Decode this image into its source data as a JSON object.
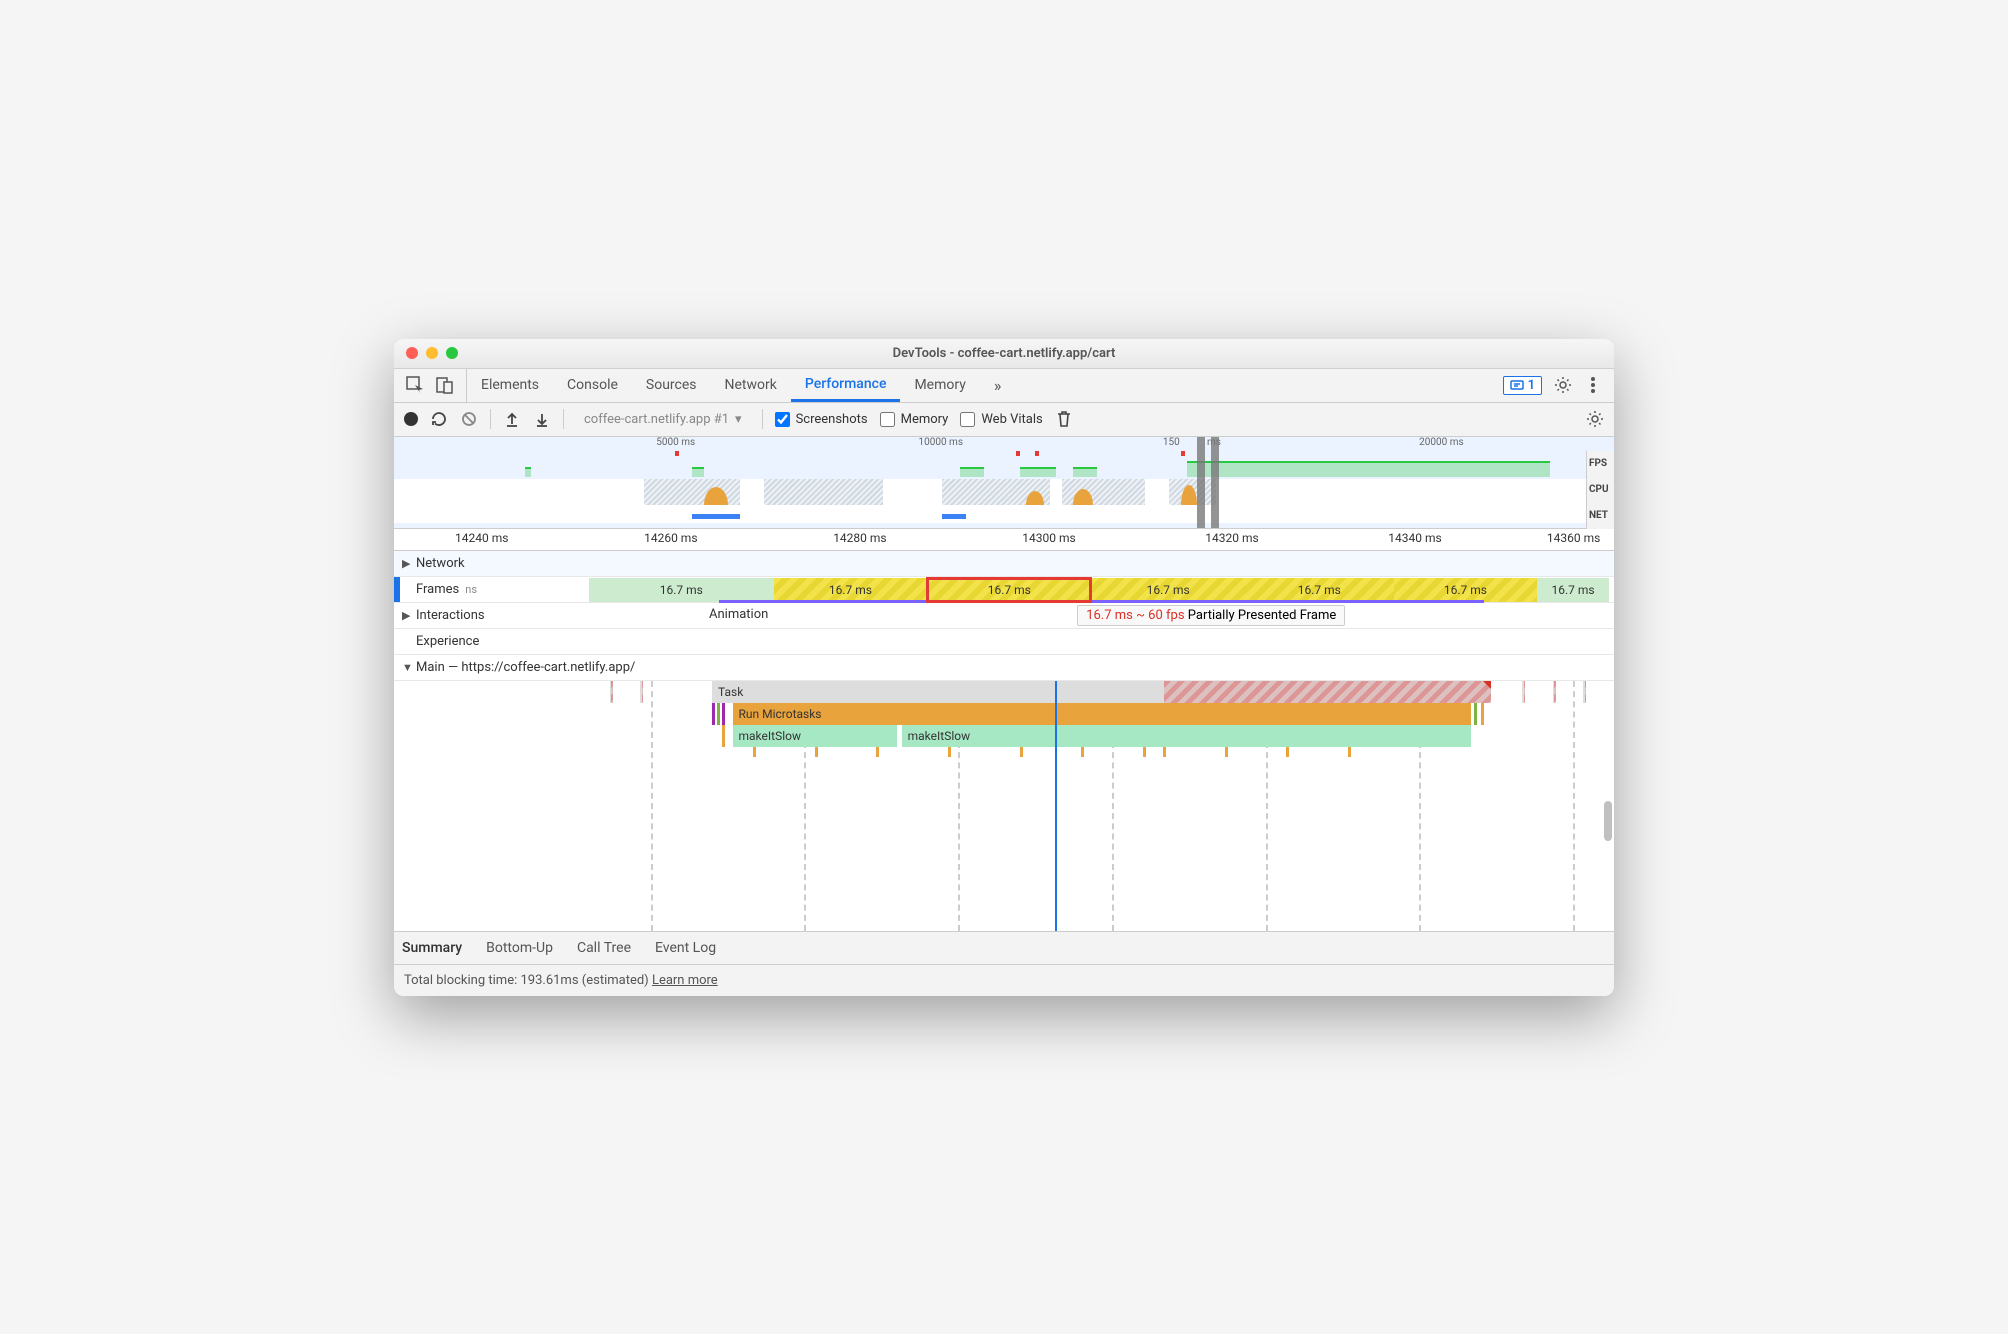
{
  "window": {
    "title": "DevTools - coffee-cart.netlify.app/cart"
  },
  "tabs": {
    "items": [
      "Elements",
      "Console",
      "Sources",
      "Network",
      "Performance",
      "Memory"
    ],
    "active": 4,
    "more": "»",
    "issues_count": "1"
  },
  "toolbar": {
    "dropdown": "coffee-cart.netlify.app #1",
    "screenshots": {
      "label": "Screenshots",
      "checked": true
    },
    "memory": {
      "label": "Memory",
      "checked": false
    },
    "webvitals": {
      "label": "Web Vitals",
      "checked": false
    }
  },
  "overview": {
    "ticks": [
      "5000 ms",
      "10000 ms",
      "150",
      "ms",
      "20000 ms"
    ],
    "labels": [
      "FPS",
      "CPU",
      "NET"
    ]
  },
  "ruler": {
    "ticks": [
      "14240 ms",
      "14260 ms",
      "14280 ms",
      "14300 ms",
      "14320 ms",
      "14340 ms",
      "14360 ms"
    ]
  },
  "tracks": {
    "network": "Network",
    "frames": {
      "label": "Frames",
      "sublabel": "ns",
      "cells": [
        "16.7 ms",
        "16.7 ms",
        "16.7 ms",
        "16.7 ms",
        "16.7 ms",
        "16.7 ms",
        "16.7 ms"
      ],
      "tooltip_time": "16.7 ms ~ 60 fps",
      "tooltip_text": "Partially Presented Frame"
    },
    "interactions": {
      "label": "Interactions",
      "value": "Animation"
    },
    "experience": "Experience",
    "main": {
      "label": "Main — https://coffee-cart.netlify.app/",
      "task": "Task",
      "microtasks": "Run Microtasks",
      "fn1": "makeItSlow",
      "fn2": "makeItSlow"
    }
  },
  "details": {
    "tabs": [
      "Summary",
      "Bottom-Up",
      "Call Tree",
      "Event Log"
    ],
    "active": 0
  },
  "footer": {
    "text": "Total blocking time: 193.61ms (estimated)",
    "link": "Learn more"
  }
}
